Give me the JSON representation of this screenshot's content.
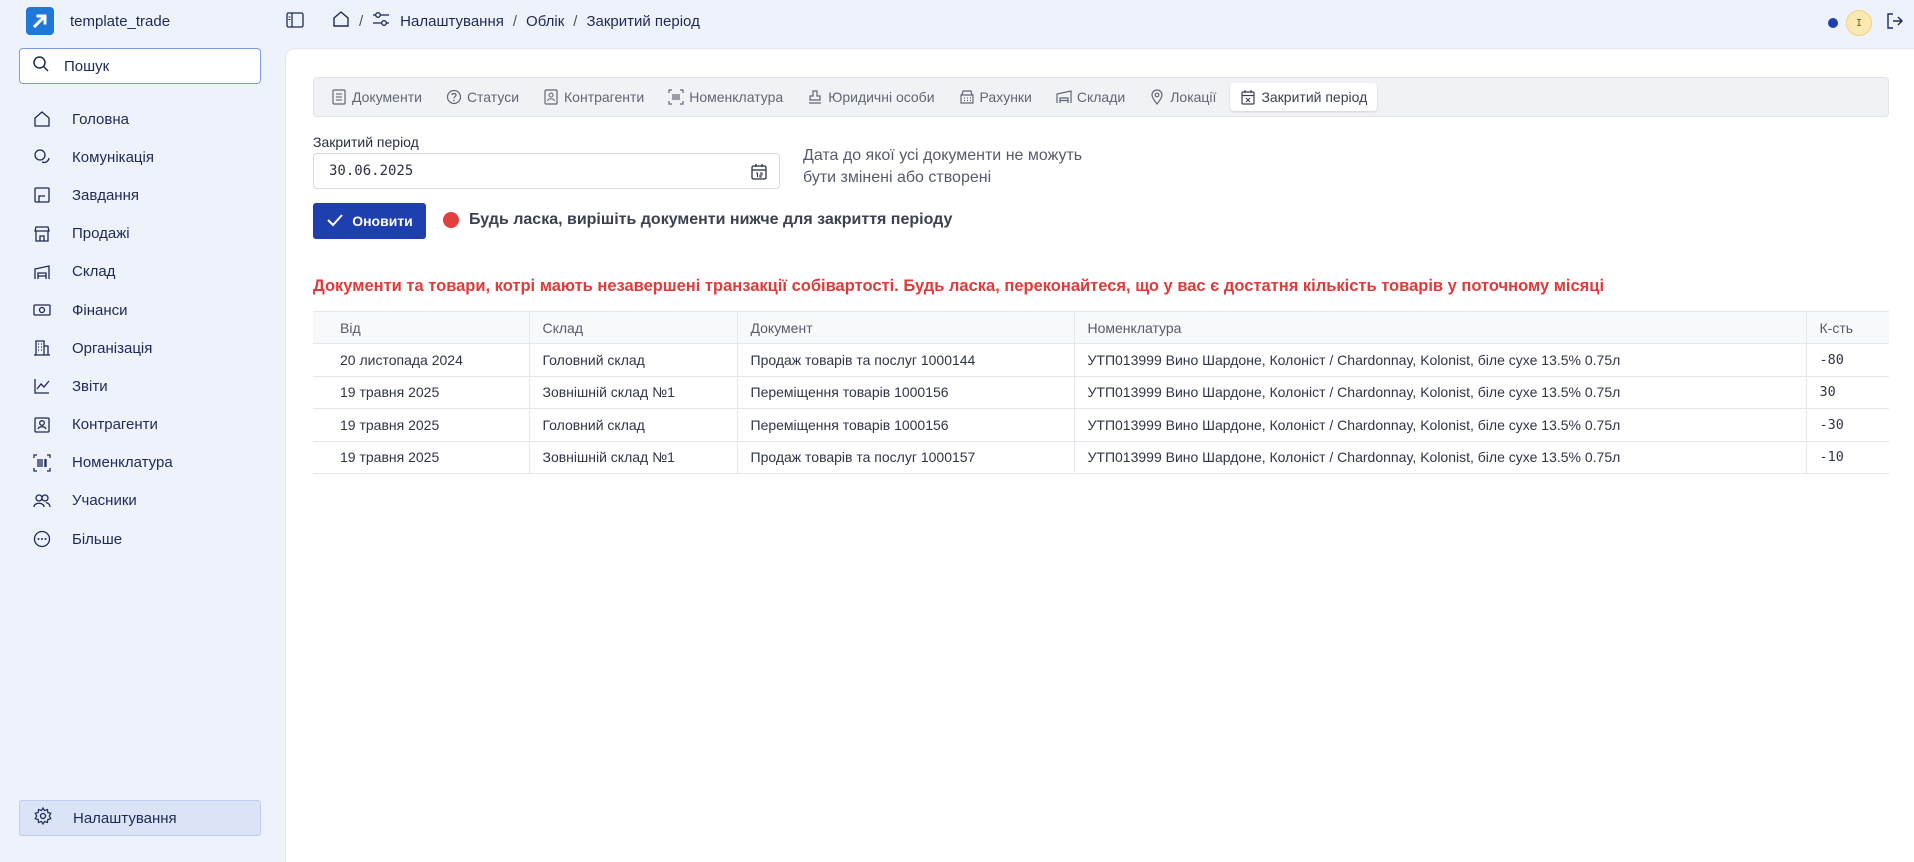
{
  "app": {
    "name": "template_trade"
  },
  "search": {
    "placeholder": "Пошук"
  },
  "sidebar": {
    "items": [
      {
        "label": "Головна",
        "icon": "home-icon"
      },
      {
        "label": "Комунікація",
        "icon": "chat-icon"
      },
      {
        "label": "Завдання",
        "icon": "tasks-icon"
      },
      {
        "label": "Продажі",
        "icon": "store-icon"
      },
      {
        "label": "Склад",
        "icon": "warehouse-icon"
      },
      {
        "label": "Фінанси",
        "icon": "money-icon"
      },
      {
        "label": "Організація",
        "icon": "building-icon"
      },
      {
        "label": "Звіти",
        "icon": "chart-icon"
      },
      {
        "label": "Контрагенти",
        "icon": "contact-icon"
      },
      {
        "label": "Номенклатура",
        "icon": "barcode-icon"
      },
      {
        "label": "Учасники",
        "icon": "users-icon"
      },
      {
        "label": "Більше",
        "icon": "more-icon"
      }
    ],
    "settings_label": "Налаштування"
  },
  "breadcrumb": {
    "settings": "Налаштування",
    "accounting": "Облік",
    "current": "Закритий період",
    "separator": "/"
  },
  "user": {
    "initial": "I"
  },
  "tabs": [
    {
      "label": "Документи",
      "icon": "document-icon"
    },
    {
      "label": "Статуси",
      "icon": "question-icon"
    },
    {
      "label": "Контрагенти",
      "icon": "contact-icon"
    },
    {
      "label": "Номенклатура",
      "icon": "barcode-icon"
    },
    {
      "label": "Юридичні особи",
      "icon": "stamp-icon"
    },
    {
      "label": "Рахунки",
      "icon": "bank-icon"
    },
    {
      "label": "Склади",
      "icon": "warehouse-icon"
    },
    {
      "label": "Локації",
      "icon": "location-icon"
    },
    {
      "label": "Закритий період",
      "icon": "calendar-icon",
      "active": true
    }
  ],
  "closed_period": {
    "label": "Закритий період",
    "value": "30.06.2025",
    "hint": "Дата до якої усі документи не можуть бути змінені або створені"
  },
  "actions": {
    "refresh_label": "Оновити"
  },
  "warning": {
    "text": "Будь ласка, вирішіть документи нижче для закриття періоду",
    "color": "#e04040"
  },
  "error_title": "Документи та товари, котрі мають незавершені транзакції собівартості. Будь ласка, переконайтеся, що у вас є достатня кількість товарів у поточному місяці",
  "table": {
    "headers": [
      "Від",
      "Склад",
      "Документ",
      "Номенклатура",
      "К-сть"
    ],
    "rows": [
      [
        "20 листопада 2024",
        "Головний склад",
        "Продаж товарів та послуг 1000144",
        "УТП013999 Вино Шардоне, Колоніст / Chardonnay, Kolonist, біле сухе 13.5% 0.75л",
        "-80"
      ],
      [
        "19 травня 2025",
        "Зовнішній склад №1",
        "Переміщення товарів 1000156",
        "УТП013999 Вино Шардоне, Колоніст / Chardonnay, Kolonist, біле сухе 13.5% 0.75л",
        "30"
      ],
      [
        "19 травня 2025",
        "Головний склад",
        "Переміщення товарів 1000156",
        "УТП013999 Вино Шардоне, Колоніст / Chardonnay, Kolonist, біле сухе 13.5% 0.75л",
        "-30"
      ],
      [
        "19 травня 2025",
        "Зовнішній склад №1",
        "Продаж товарів та послуг 1000157",
        "УТП013999 Вино Шардоне, Колоніст / Chardonnay, Kolonist, біле сухе 13.5% 0.75л",
        "-10"
      ]
    ]
  },
  "colors": {
    "primary": "#1e3fae",
    "error": "#e03a3a",
    "sidebar_bg": "#eef2fa"
  }
}
